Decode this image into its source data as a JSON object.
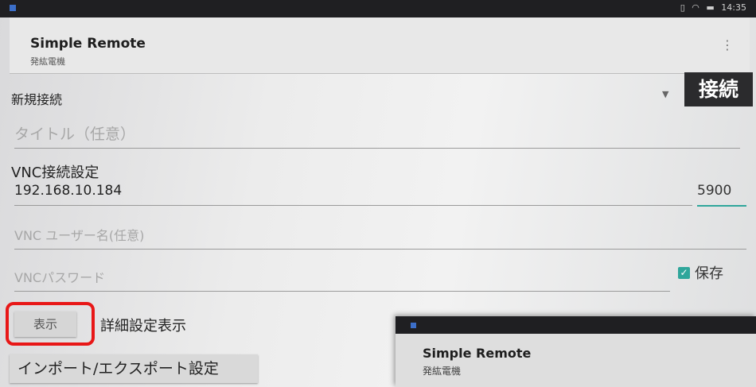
{
  "status_bar": {
    "time": "14:35",
    "icons": [
      "vibrate-icon",
      "wifi-icon",
      "battery-icon"
    ]
  },
  "app_bar": {
    "title": "Simple Remote",
    "subtitle": "発紘電機",
    "menu_icon": "more-vert-icon"
  },
  "connection": {
    "selected": "新規接続",
    "connect_label": "接続"
  },
  "title_field": {
    "placeholder": "タイトル（任意）",
    "value": ""
  },
  "vnc_section_label": "VNC接続設定",
  "host_field": {
    "value": "192.168.10.184"
  },
  "port_field": {
    "value": "5900"
  },
  "user_field": {
    "placeholder": "VNC ユーザー名(任意)",
    "value": ""
  },
  "password_field": {
    "placeholder": "VNCパスワード",
    "value": ""
  },
  "save_checkbox": {
    "label": "保存",
    "checked": true
  },
  "advanced": {
    "button_label": "表示",
    "label": "詳細設定表示"
  },
  "import_export_label": "インポート/エクスポート設定",
  "overlay_screenshot": {
    "title": "Simple Remote",
    "subtitle": "発紘電機"
  },
  "colors": {
    "accent": "#2fa69b",
    "highlight": "#e81717",
    "status_bar": "#1f1f22"
  }
}
